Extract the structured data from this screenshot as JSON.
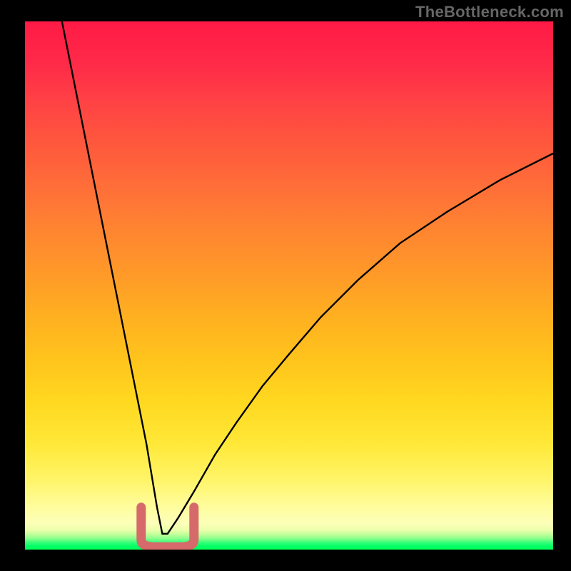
{
  "watermark": "TheBottleneck.com",
  "chart_data": {
    "type": "line",
    "title": "",
    "xlabel": "",
    "ylabel": "",
    "xlim": [
      0,
      100
    ],
    "ylim": [
      0,
      100
    ],
    "grid": false,
    "legend": false,
    "notes": "Bottleneck-style V curve. x roughly component balance (0–100). y roughly bottleneck % (0 at floor/green, 100 at top/red). Minimum around x≈26. Left branch steep, right branch shallower rising to ~75 at x=100. Red rounded U marker sits on the green floor around the minimum spanning roughly x≈22–32.",
    "series": [
      {
        "name": "bottleneck-curve",
        "x": [
          7,
          9,
          11,
          13,
          15,
          17,
          19,
          21,
          23,
          25,
          26,
          27,
          29,
          32,
          36,
          40,
          45,
          50,
          56,
          63,
          71,
          80,
          90,
          100
        ],
        "y": [
          100,
          90,
          80,
          70,
          60,
          50,
          40,
          30,
          20,
          8,
          3,
          3,
          6,
          11,
          18,
          24,
          31,
          37,
          44,
          51,
          58,
          64,
          70,
          75
        ]
      }
    ],
    "marker": {
      "name": "optimal-u-marker",
      "color": "#d66a6a",
      "x_range": [
        22,
        32
      ],
      "y_top": 8,
      "y_bottom": 0.5
    },
    "gradient_stops_pct_from_top": {
      "red": 0,
      "orange": 45,
      "yellow": 80,
      "pale_yellow": 94,
      "green_start": 96.5,
      "green_end": 100
    }
  }
}
